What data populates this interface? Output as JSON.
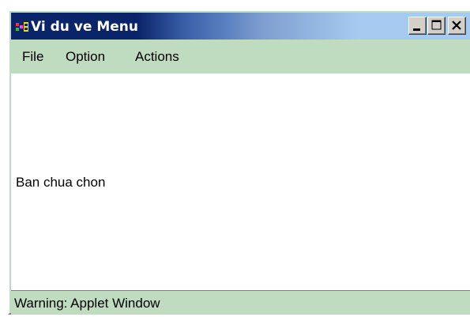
{
  "window": {
    "title": "Vi du ve Menu",
    "app_icon": "java-applet-icon",
    "controls": {
      "minimize_icon": "minimize-icon",
      "maximize_icon": "maximize-icon",
      "close_icon": "close-icon"
    }
  },
  "menubar": {
    "items": [
      {
        "label": "File"
      },
      {
        "label": "Option"
      },
      {
        "label": "Actions"
      }
    ]
  },
  "content": {
    "label": "Ban chua chon"
  },
  "statusbar": {
    "text": "Warning: Applet Window"
  },
  "colors": {
    "title_active": "#0a246a",
    "title_gradient_end": "#a6caf0",
    "window_background": "#c0dcc0",
    "content_background": "#ffffff"
  }
}
